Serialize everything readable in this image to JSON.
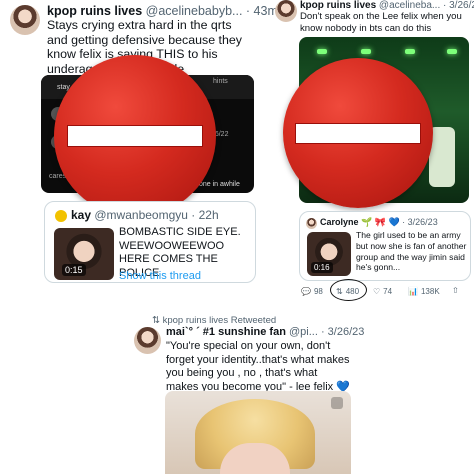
{
  "tweet_left": {
    "name": "kpop ruins lives",
    "handle_time": "@acelinebabyb... · 43m",
    "text": "Stays crying extra hard in the qrts and getting defensive because they know felix is saying THIS to his underage fans on bubble",
    "media_text": [
      "stay",
      "hints",
      "3/6/22",
      "one in awhile",
      "cares"
    ],
    "quote": {
      "name": "kay",
      "handle_time": "@mwanbeomgyu · 22h",
      "text": "BOMBASTIC SIDE EYE. WEEWOOWEEWOO HERE COMES THE POLICE",
      "thread_label": "Show this thread",
      "video_duration": "0:15"
    }
  },
  "tweet_right": {
    "name": "kpop ruins lives",
    "handle_time": "@acelineba... · 3/26/23",
    "text": "Don't speak on the Lee felix when you know nobody in bts can do this",
    "quote": {
      "name": "Carolyne",
      "name_emojis": "🌱 🎀 💙",
      "time": "· 3/26/23",
      "text": "The girl used to be an army but now she is fan of another group and the way jimin said he's gonn...",
      "video_duration": "0:16"
    },
    "actions": {
      "replies": "98",
      "retweets": "480",
      "likes": "74",
      "views": "138K"
    }
  },
  "tweet_bottom": {
    "retweet_label": "kpop ruins lives Retweeted",
    "name": "mai`° ´ #1 sunshine fan",
    "handle_time": "@pi... · 3/26/23",
    "text": "\"You're special on your own, don't forget your identity..that's what makes you being you , no , that's what makes you become you\" - lee felix 💙"
  },
  "colors": {
    "link": "#1d9bf0",
    "stop_red": "#d42a1f",
    "green_stage": "#1f5b2a"
  }
}
